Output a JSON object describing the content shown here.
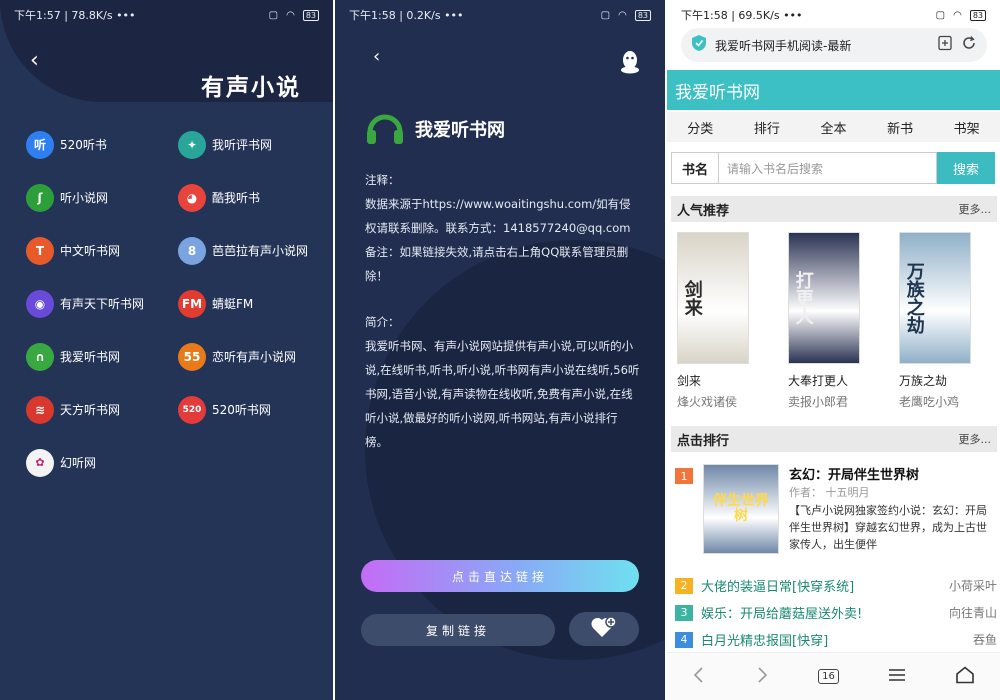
{
  "screen1": {
    "status": {
      "time": "下午1:57",
      "speed": "78.8K/s",
      "dots": "•••",
      "battery": "83"
    },
    "back_glyph": "‹",
    "title": "有声小说",
    "sites": [
      {
        "label": "520听书",
        "icon": "ting-icon",
        "glyph": "听",
        "color": "#2e7ff0"
      },
      {
        "label": "我听评书网",
        "icon": "mic-icon",
        "glyph": "✦",
        "color": "#2aa59a"
      },
      {
        "label": "听小说网",
        "icon": "leaf-icon",
        "glyph": "ʃ",
        "color": "#2c9e3a"
      },
      {
        "label": "酷我听书",
        "icon": "kuwo-icon",
        "glyph": "◕",
        "color": "#e8443b"
      },
      {
        "label": "中文听书网",
        "icon": "headphone-red-icon",
        "glyph": "T",
        "color": "#e85a2a"
      },
      {
        "label": "芭芭拉有声小说网",
        "icon": "barbara-icon",
        "glyph": "8",
        "color": "#7aa3e0"
      },
      {
        "label": "有声天下听书网",
        "icon": "eye-icon",
        "glyph": "◉",
        "color": "#6a4ad8"
      },
      {
        "label": "蜻蜓FM",
        "icon": "dragonfly-icon",
        "glyph": "FM",
        "color": "#e23b2f"
      },
      {
        "label": "我爱听书网",
        "icon": "headphones-icon",
        "glyph": "∩",
        "color": "#3aa840"
      },
      {
        "label": "恋听有声小说网",
        "icon": "five-five-icon",
        "glyph": "55",
        "color": "#e87a1a"
      },
      {
        "label": "天方听书网",
        "icon": "stripes-icon",
        "glyph": "≋",
        "color": "#d8382e"
      },
      {
        "label": "520听书网",
        "icon": "520-icon",
        "glyph": "520",
        "color": "#e33a3a"
      },
      {
        "label": "幻听网",
        "icon": "huanting-icon",
        "glyph": "✿",
        "color": "#f3f3f3"
      }
    ]
  },
  "screen2": {
    "status": {
      "time": "下午1:58",
      "speed": "0.2K/s",
      "dots": "•••",
      "battery": "83"
    },
    "back_glyph": "‹",
    "brand_name": "我爱听书网",
    "note_heading": "注释：",
    "note_line": "数据来源于https://www.woaitingshu.com/如有侵权请联系删除。联系方式：1418577240@qq.com",
    "note_remark": "备注：如果链接失效,请点击右上角QQ联系管理员删除！",
    "intro_heading": "简介：",
    "intro_text": "我爱听书网、有声小说网站提供有声小说,可以听的小说,在线听书,听书,听小说,听书网有声小说在线听,56听书网,语音小说,有声读物在线收听,免费有声小说,在线听小说,做最好的听小说网,听书网站,有声小说排行榜。",
    "open_link_label": "点击直达链接",
    "copy_link_label": "复制链接"
  },
  "screen3": {
    "status": {
      "time": "下午1:58",
      "speed": "69.5K/s",
      "dots": "•••",
      "battery": "83"
    },
    "url_title": "我爱听书网手机阅读-最新",
    "site_name": "我爱听书网",
    "nav": [
      "分类",
      "排行",
      "全本",
      "新书",
      "书架"
    ],
    "search": {
      "label": "书名",
      "placeholder": "请输入书名后搜索",
      "button": "搜索"
    },
    "popular": {
      "title": "人气推荐",
      "more": "更多..."
    },
    "books": [
      {
        "name": "剑来",
        "author": "烽火戏诸侯",
        "cover_text": "剑来",
        "cover_bg": "#d9d4c8",
        "cover_fg": "#2b2b2b"
      },
      {
        "name": "大奉打更人",
        "author": "卖报小郎君",
        "cover_text": "打更人",
        "cover_bg": "#2b3354",
        "cover_fg": "#f0f0f0"
      },
      {
        "name": "万族之劫",
        "author": "老鹰吃小鸡",
        "cover_text": "万族之劫",
        "cover_bg": "#8fb0c8",
        "cover_fg": "#1e3550"
      }
    ],
    "ranking": {
      "title": "点击排行",
      "more": "更多..."
    },
    "top1": {
      "rank": "1",
      "name": "玄幻：开局伴生世界树",
      "author": "作者：  十五明月",
      "desc": "【飞卢小说网独家签约小说：玄幻：开局伴生世界树】穿越玄幻世界，成为上古世家传人，出生便伴",
      "cover_text": "伴生世界树",
      "cover_bg": "#6f88a8"
    },
    "rank_items": [
      {
        "rank": "2",
        "title": "大佬的装逼日常[快穿系统]",
        "author": "小荷采叶",
        "color": "#f5b221"
      },
      {
        "rank": "3",
        "title": "娱乐：开局给蘑菇屋送外卖!",
        "author": "向往青山",
        "color": "#3cb5a0"
      },
      {
        "rank": "4",
        "title": "白月光精忠报国[快穿]",
        "author": "吞鱼",
        "color": "#3c8de0"
      }
    ],
    "tab_count": "16"
  }
}
